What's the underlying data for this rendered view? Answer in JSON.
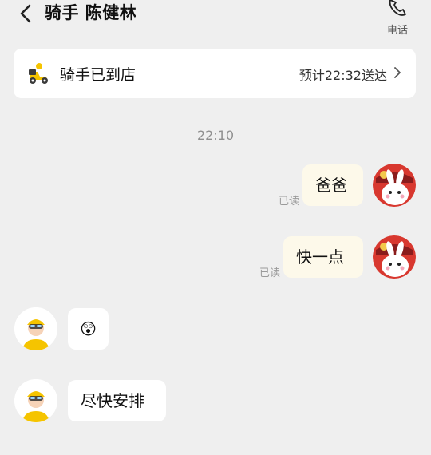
{
  "header": {
    "title": "骑手 陈健林",
    "phone_label": "电话"
  },
  "status": {
    "text": "骑手已到店",
    "eta": "预计22:32送达"
  },
  "timestamp": "22:10",
  "messages": [
    {
      "sender": "me",
      "text": "爸爸",
      "read_label": "已读"
    },
    {
      "sender": "me",
      "text": "快一点",
      "read_label": "已读"
    },
    {
      "sender": "rider",
      "emoji": "😲"
    },
    {
      "sender": "rider",
      "text": "尽快安排"
    }
  ],
  "colors": {
    "my_bubble": "#fdf9ea",
    "their_bubble": "#ffffff",
    "background": "#efefef"
  }
}
